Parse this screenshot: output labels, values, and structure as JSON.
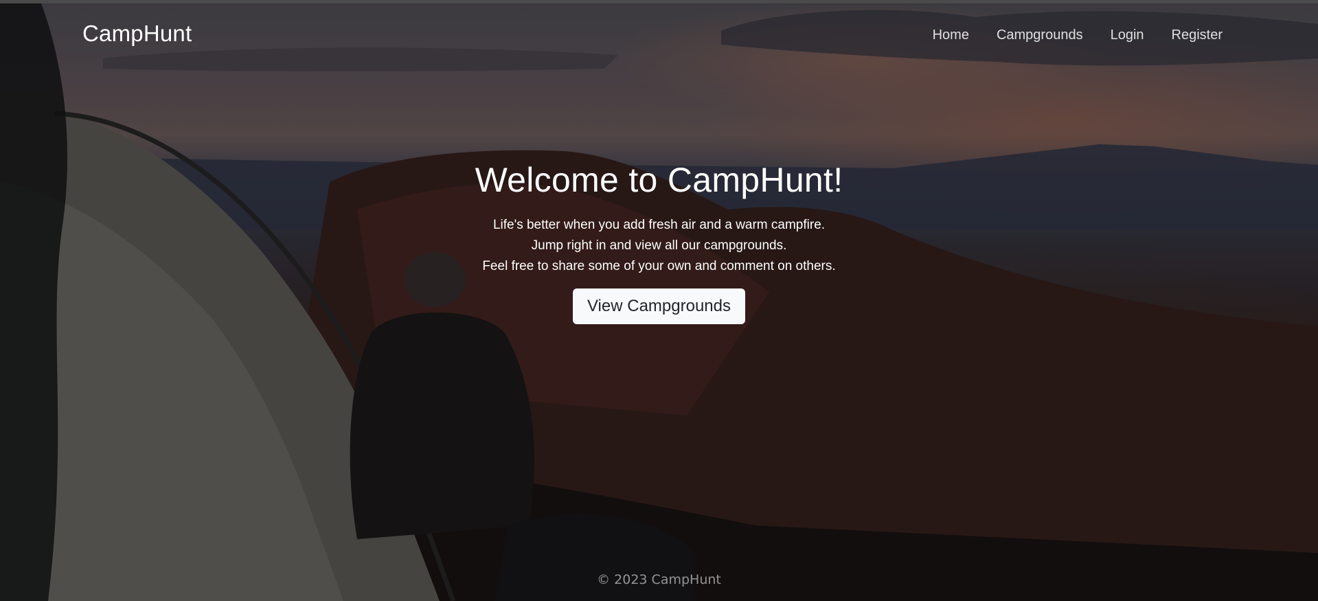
{
  "header": {
    "brand": "CampHunt",
    "nav": {
      "home": "Home",
      "campgrounds": "Campgrounds",
      "login": "Login",
      "register": "Register"
    }
  },
  "hero": {
    "title": "Welcome to CampHunt!",
    "lines": [
      "Life's better when you add fresh air and a warm campfire.",
      "Jump right in and view all our campgrounds.",
      "Feel free to share some of your own and comment on others."
    ],
    "cta_label": "View Campgrounds"
  },
  "footer": {
    "text": "© 2023 CampHunt"
  }
}
